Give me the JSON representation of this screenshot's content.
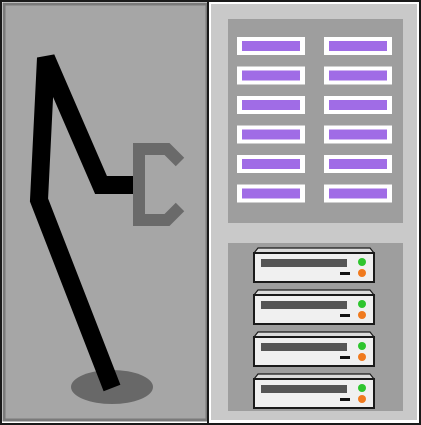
{
  "scene": {
    "kind": "tape-library-illustration",
    "colors": {
      "outline": "#1a1a1a",
      "robot_bay": "#a6a6a6",
      "robot_bay_border": "#7a7a7a",
      "cabinet": "#c9c9c9",
      "cabinet_inner": "#b9b9b9",
      "panel": "#9e9e9e",
      "arm": "#000000",
      "gripper": "#6a6a6a",
      "base_shadow": "#686868",
      "slot_face": "#ffffff",
      "tape_label": "#a06ce6",
      "server_face": "#f0f0f0",
      "server_bar": "#555555",
      "led_green": "#2ec52e",
      "led_orange": "#f07a1e"
    },
    "robot": {
      "arm_icon": "robotic-arm-icon",
      "gripper_icon": "gripper-claw-icon"
    },
    "tape_rack": {
      "columns": 2,
      "rows": 6
    },
    "server_rack": {
      "units": 4,
      "icon": "server-unit-icon"
    }
  }
}
